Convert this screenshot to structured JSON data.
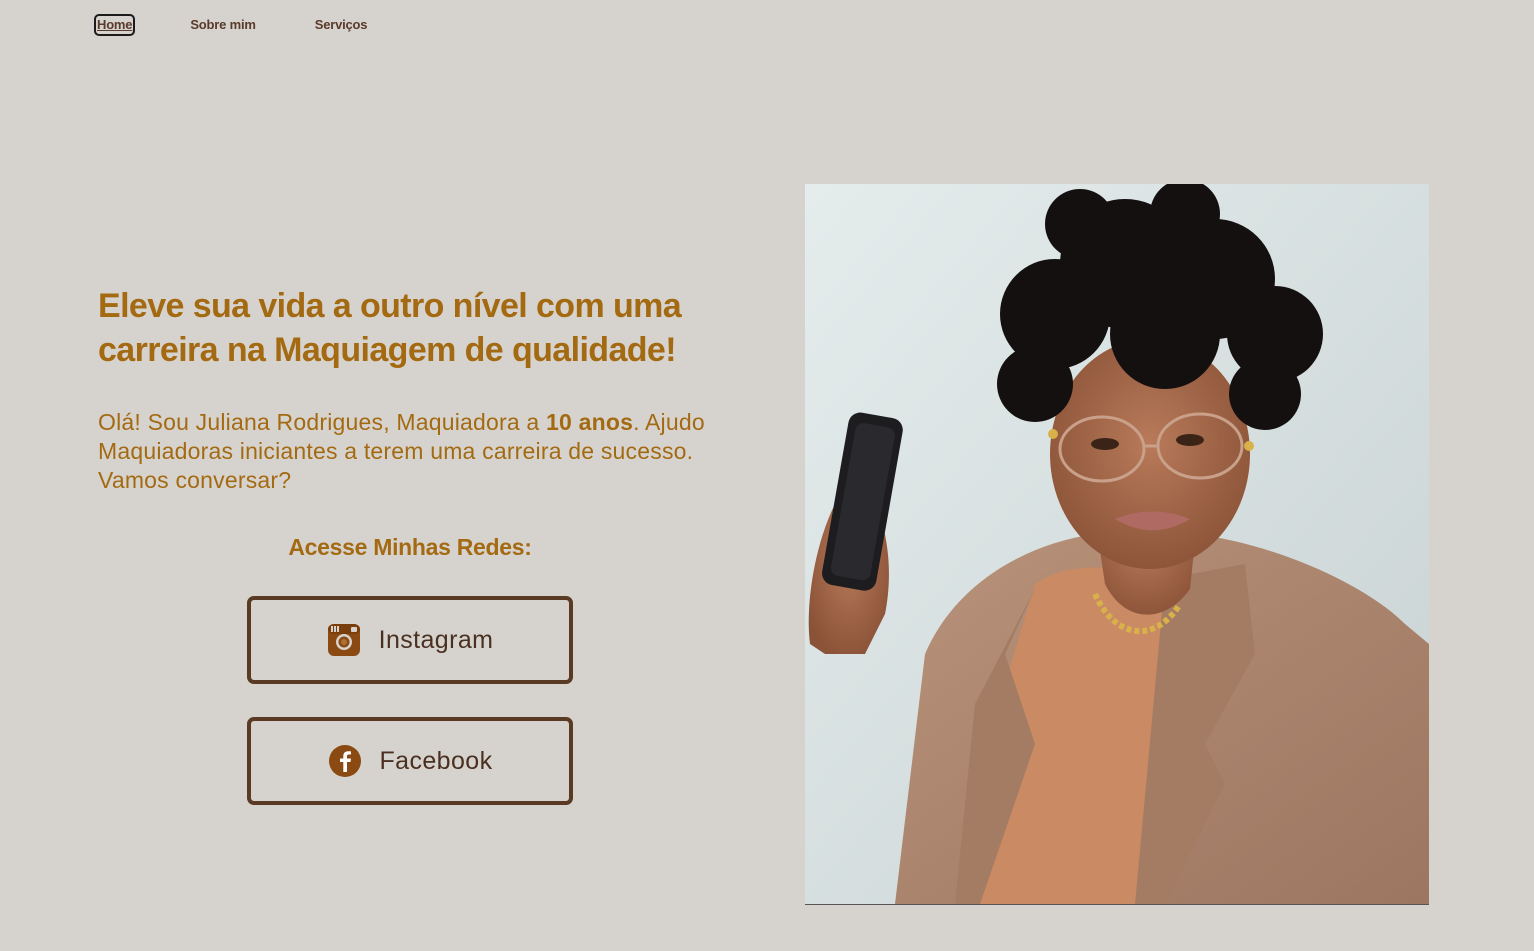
{
  "nav": {
    "links": [
      "Home",
      "Sobre mim",
      "Serviços"
    ]
  },
  "hero": {
    "headline": "Eleve sua vida a outro nível com uma carreira na Maquiagem de qualidade!",
    "intro_before": "Olá! Sou Juliana Rodrigues, Maquiadora a ",
    "intro_bold": "10 anos",
    "intro_after": ". Ajudo Maquiadoras iniciantes a terem uma carreira de sucesso. Vamos conversar?"
  },
  "social": {
    "title": "Acesse Minhas Redes:",
    "instagram_label": "Instagram",
    "facebook_label": "Facebook",
    "instagram_icon": "instagram-icon",
    "facebook_icon": "facebook-icon"
  },
  "colors": {
    "background": "#d6d3cf",
    "accent": "#a46a12",
    "button_border": "#5a3a22",
    "icon": "#8a4a12"
  }
}
